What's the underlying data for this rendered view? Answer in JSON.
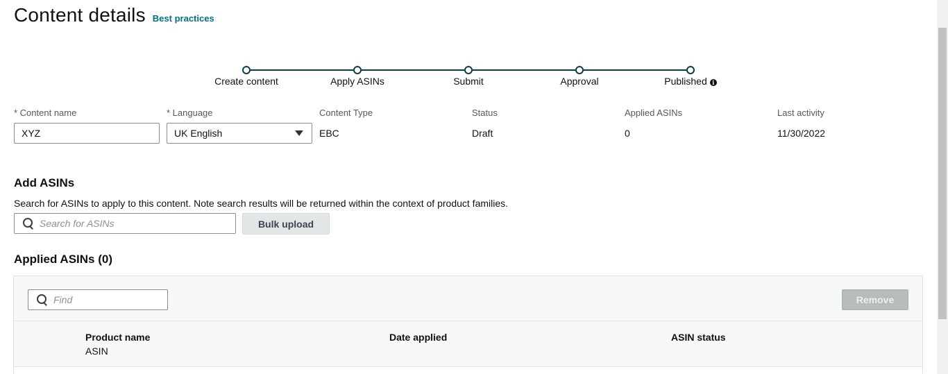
{
  "header": {
    "title": "Content details",
    "best_practices_link": "Best practices"
  },
  "stepper": {
    "steps": [
      {
        "label": "Create content"
      },
      {
        "label": "Apply ASINs"
      },
      {
        "label": "Submit"
      },
      {
        "label": "Approval"
      },
      {
        "label": "Published"
      }
    ],
    "info_icon_glyph": "i"
  },
  "fields": {
    "content_name": {
      "label": "* Content name",
      "value": "XYZ"
    },
    "language": {
      "label": "* Language",
      "value": "UK English"
    },
    "content_type": {
      "label": "Content Type",
      "value": "EBC"
    },
    "status": {
      "label": "Status",
      "value": "Draft"
    },
    "applied_asins": {
      "label": "Applied ASINs",
      "value": "0"
    },
    "last_activity": {
      "label": "Last activity",
      "value": "11/30/2022"
    }
  },
  "add_asins": {
    "title": "Add ASINs",
    "description": "Search for ASINs to apply to this content. Note search results will be returned within the context of product families.",
    "search_placeholder": "Search for ASINs",
    "bulk_upload_label": "Bulk upload"
  },
  "applied_section": {
    "title": "Applied ASINs (0)",
    "find_placeholder": "Find",
    "remove_label": "Remove",
    "columns": {
      "product_name": "Product name",
      "product_sub": "ASIN",
      "date_applied": "Date applied",
      "asin_status": "ASIN status"
    }
  },
  "colors": {
    "link": "#007185",
    "stepper": "#0b3d45",
    "disabled_button": "#b6bcbc"
  }
}
